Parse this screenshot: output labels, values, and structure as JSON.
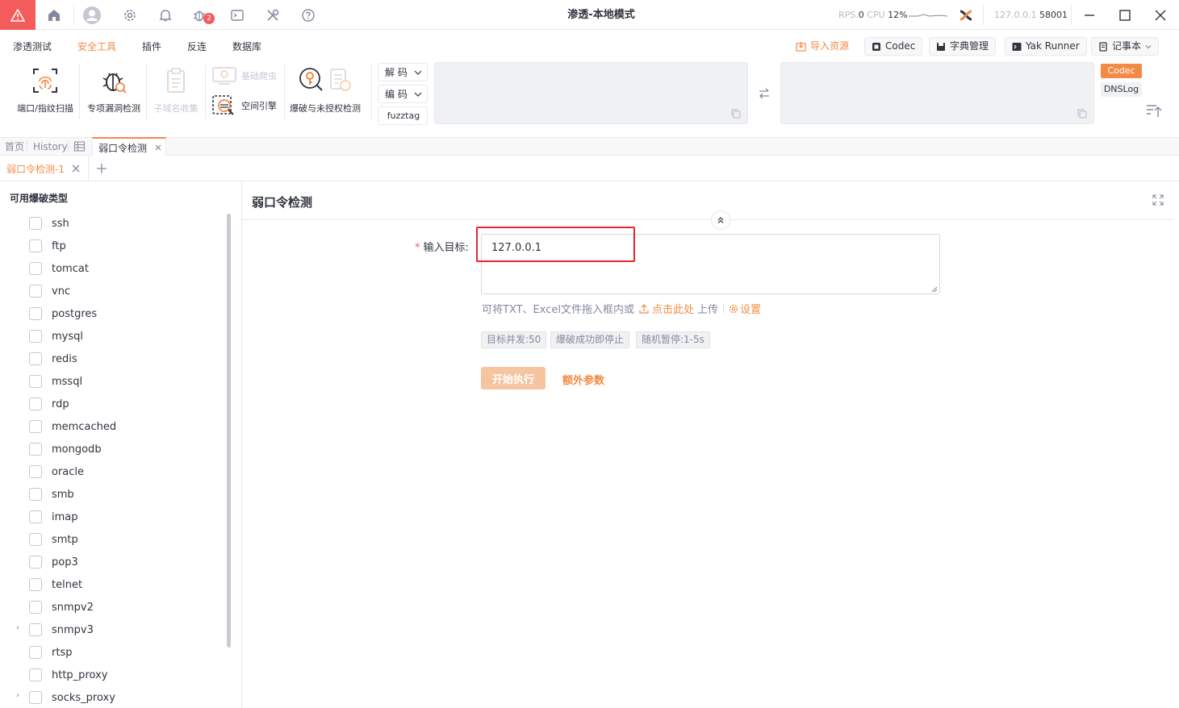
{
  "titlebar": {
    "title": "渗透-本地模式",
    "rps_label": "RPS",
    "rps_value": "0",
    "cpu_label": "CPU",
    "cpu_value": "12%",
    "host": "127.0.0.1",
    "port": "58001",
    "notification_badge": "2",
    "icons": [
      "warning-icon",
      "home-icon",
      "user-avatar-icon",
      "gear-icon",
      "bell-icon",
      "bug-icon",
      "terminal-icon",
      "tools-icon",
      "help-icon",
      "plugin-status-icon",
      "minimize-icon",
      "maximize-icon",
      "close-icon"
    ]
  },
  "menu": {
    "items": [
      "渗透测试",
      "安全工具",
      "插件",
      "反连",
      "数据库"
    ],
    "active_index": 1,
    "import_label": "导入资源",
    "codec_label": "Codec",
    "dict_label": "字典管理",
    "yak_runner_label": "Yak Runner",
    "notebook_label": "记事本"
  },
  "tools": {
    "port_scan": "端口/指纹扫描",
    "vuln_detect": "专项漏洞检测",
    "subdomain": "子域名收集",
    "crawler": "基础爬虫",
    "space_engine": "空间引擎",
    "bruteforce": "爆破与未授权检测",
    "decode": "解 码",
    "encode": "编 码",
    "fuzztag": "fuzztag",
    "codec_tag": "Codec",
    "dnslog_tag": "DNSLog"
  },
  "tabs": {
    "home": "首页",
    "history": "History",
    "active": "弱口令检测",
    "subtab": "弱口令检测-1"
  },
  "left": {
    "title": "可用爆破类型",
    "items": [
      "ssh",
      "ftp",
      "tomcat",
      "vnc",
      "postgres",
      "mysql",
      "redis",
      "mssql",
      "rdp",
      "memcached",
      "mongodb",
      "oracle",
      "smb",
      "imap",
      "smtp",
      "pop3",
      "telnet",
      "snmpv2",
      "snmpv3",
      "rtsp",
      "http_proxy",
      "socks_proxy"
    ]
  },
  "main": {
    "title": "弱口令检测",
    "target_label": "输入目标:",
    "target_value": "127.0.0.1",
    "hint_prefix": "可将TXT、Excel文件拖入框内或",
    "hint_link": "点击此处",
    "hint_suffix": "上传",
    "settings_label": "设置",
    "tags": [
      "目标并发:50",
      "爆破成功即停止",
      "随机暂停:1-5s"
    ],
    "start_label": "开始执行",
    "extra_label": "额外参数"
  },
  "colors": {
    "accent": "#f28b44",
    "danger": "#f45b5b",
    "highlight": "#e8262c"
  }
}
